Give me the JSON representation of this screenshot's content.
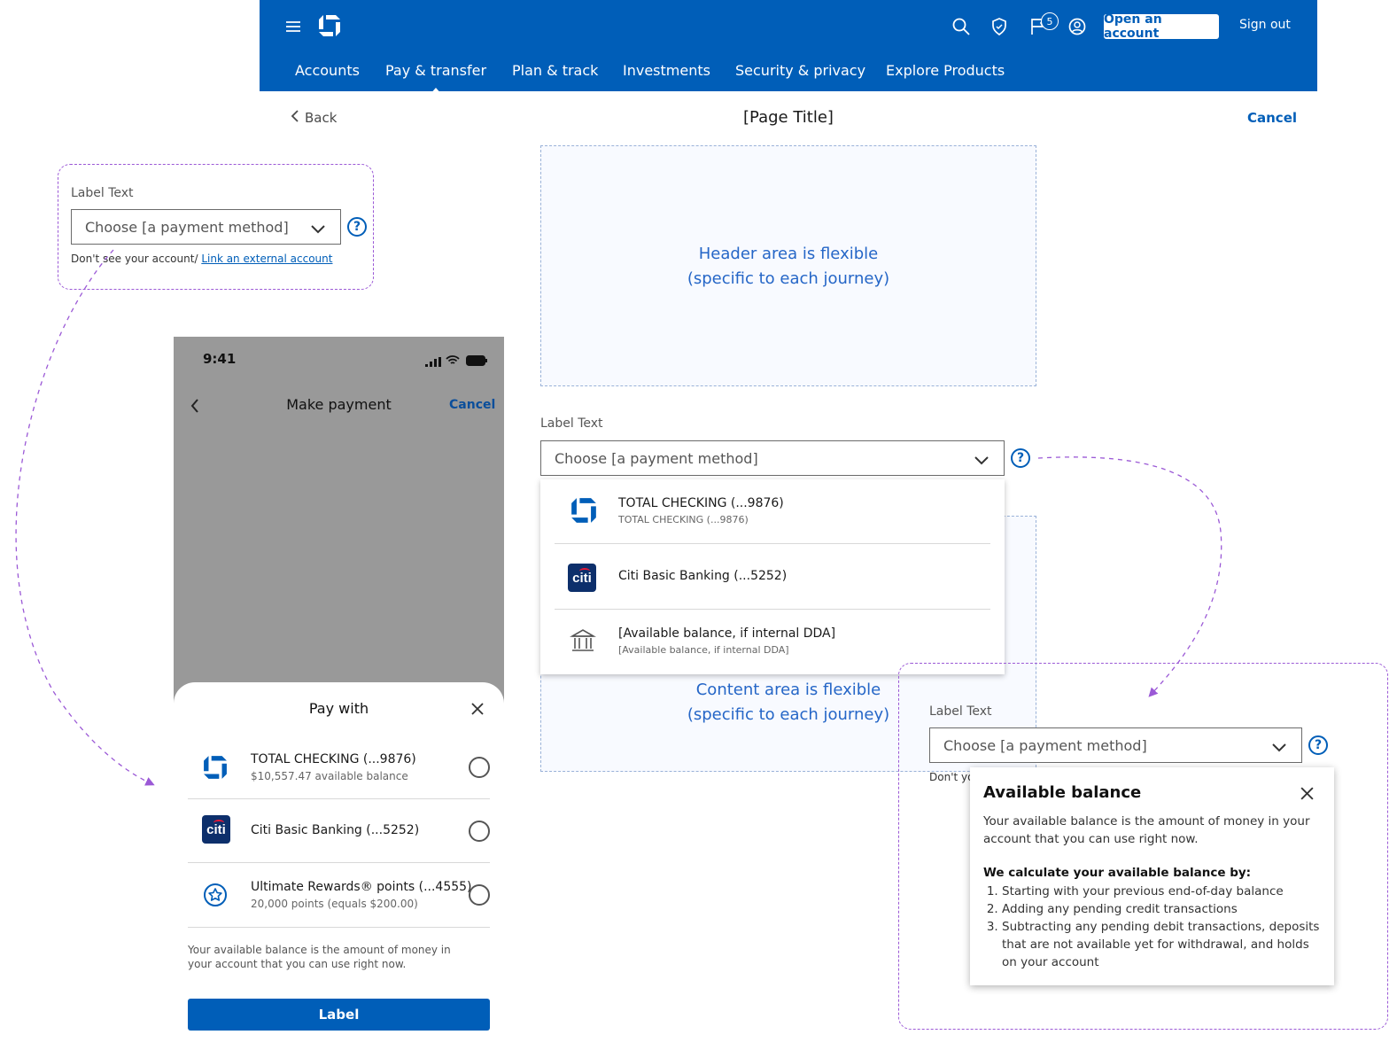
{
  "colors": {
    "brand_blue": "#005eb8",
    "callout_purple": "#9b59d6",
    "flex_text_blue": "#2566c7"
  },
  "icons": [
    "menu-icon",
    "chase-logo",
    "search-icon",
    "shield-icon",
    "flag-icon",
    "profile-icon",
    "chevron-left-icon",
    "chevron-down-icon",
    "help-icon",
    "close-icon",
    "bank-icon",
    "star-icon"
  ],
  "topnav": {
    "notification_count": "5",
    "open_account_label": "Open an account",
    "sign_out_label": "Sign out",
    "tabs": [
      {
        "label": "Accounts"
      },
      {
        "label": "Pay & transfer"
      },
      {
        "label": "Plan & track"
      },
      {
        "label": "Investments"
      },
      {
        "label": "Security & privacy"
      },
      {
        "label": "Explore Products"
      }
    ],
    "active_tab": "Pay & transfer"
  },
  "page": {
    "back_label": "Back",
    "title": "[Page Title]",
    "cancel_label": "Cancel",
    "header_area_line1": "Header area is flexible",
    "header_area_line2": "(specific to each journey)",
    "content_area_line1": "Content area is flexible",
    "content_area_line2": "(specific to each journey)"
  },
  "field": {
    "label": "Label Text",
    "placeholder": "Choose [a payment method]",
    "helper_text": "Don't see your account/",
    "helper_link": "Link an external account",
    "helper_text_clipped": "Don't yo"
  },
  "dropdown": {
    "items": [
      {
        "primary": "TOTAL CHECKING (...9876)",
        "secondary": "TOTAL CHECKING (...9876)"
      },
      {
        "primary": "Citi Basic Banking (...5252)"
      },
      {
        "primary": "[Available balance, if internal DDA]",
        "secondary": "[Available balance, if internal DDA]"
      }
    ]
  },
  "citi_logo_text": "citi",
  "phone": {
    "time": "9:41",
    "title": "Make payment",
    "cancel_label": "Cancel",
    "sheet_title": "Pay with",
    "items": [
      {
        "primary": "TOTAL CHECKING (...9876)",
        "secondary": "$10,557.47 available balance"
      },
      {
        "primary": "Citi Basic Banking (...5252)"
      },
      {
        "primary": "Ultimate Rewards® points (...4555)",
        "secondary": "20,000 points (equals $200.00)"
      }
    ],
    "note": "Your available balance is the amount of money in your account that you can use right now.",
    "button_label": "Label"
  },
  "popover": {
    "title": "Available balance",
    "intro": "Your available balance is the amount of money in your account that you can use right now.",
    "calc_heading": "We calculate your available balance by:",
    "steps": [
      "Starting with your previous end-of-day balance",
      "Adding any pending credit transactions",
      "Subtracting any pending debit transactions, deposits that are not available yet for withdrawal, and holds on your account"
    ]
  }
}
